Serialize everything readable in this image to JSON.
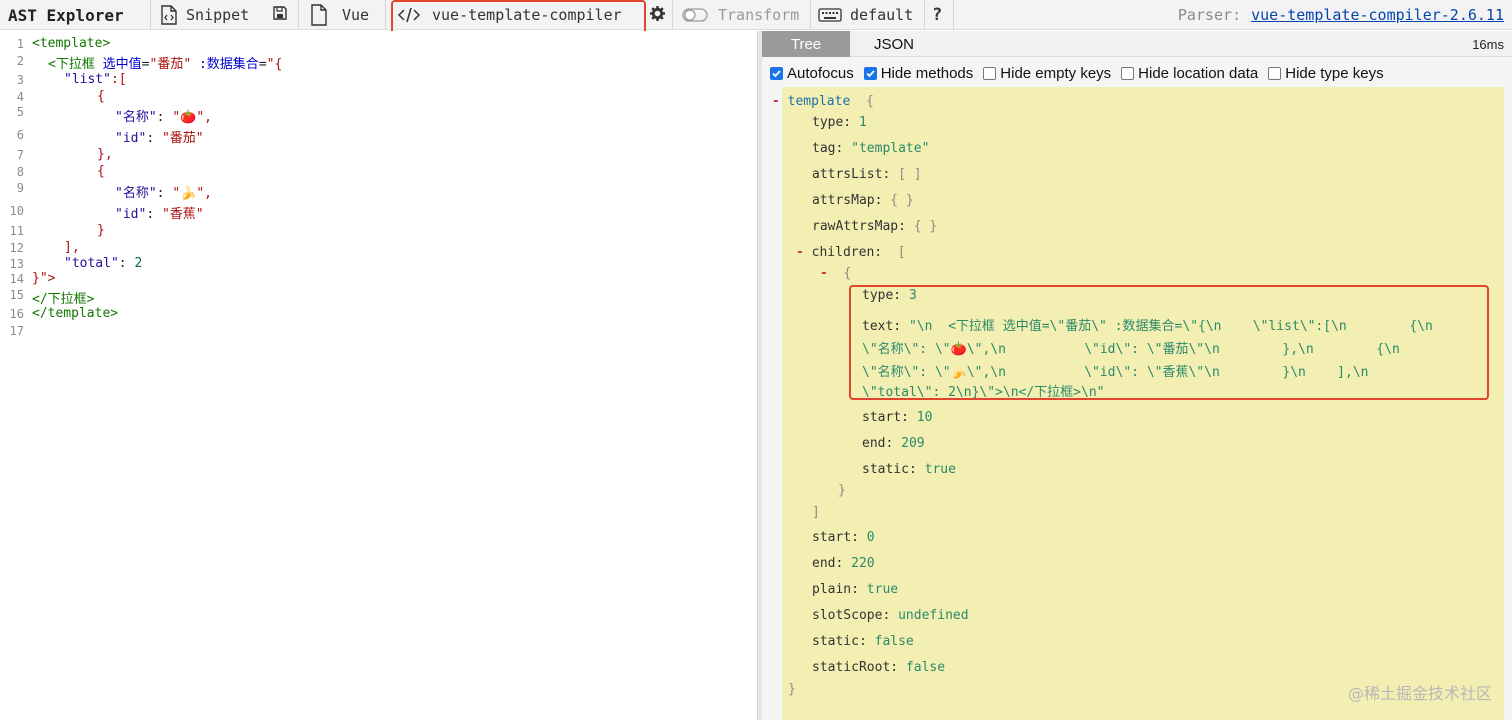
{
  "toolbar": {
    "app_title": "AST Explorer",
    "snippet_label": "Snippet",
    "language_label": "Vue",
    "parser_button_label": "vue-template-compiler",
    "transform_label": "Transform",
    "keymap_label": "default",
    "help_label": "?",
    "parser_label": "Parser:",
    "parser_link": "vue-template-compiler-2.6.11"
  },
  "editor": {
    "lines": [
      {
        "num": "1"
      },
      {
        "num": "2"
      },
      {
        "num": "3"
      },
      {
        "num": "4"
      },
      {
        "num": "5"
      },
      {
        "num": "6"
      },
      {
        "num": "7"
      },
      {
        "num": "8"
      },
      {
        "num": "9"
      },
      {
        "num": "10"
      },
      {
        "num": "11"
      },
      {
        "num": "12"
      },
      {
        "num": "13"
      },
      {
        "num": "14"
      },
      {
        "num": "15"
      },
      {
        "num": "16"
      },
      {
        "num": "17"
      }
    ],
    "code": {
      "l1": "<template>",
      "l2_tag": "<下拉框",
      "l2_attr1": "选中值",
      "l2_eq1": "=",
      "l2_val1": "\"番茄\"",
      "l2_attr2": ":数据集合",
      "l2_eq2": "=",
      "l2_val2": "\"{",
      "l3_key": "\"list\"",
      "l3_rest": ":[",
      "l4": "{",
      "l5_key": "\"名称\"",
      "l5_colon": ": ",
      "l5_val": "\"🍅\"",
      "l5_comma": ",",
      "l6_key": "\"id\"",
      "l6_colon": ": ",
      "l6_val": "\"番茄\"",
      "l7": "},",
      "l8": "{",
      "l9_key": "\"名称\"",
      "l9_colon": ": ",
      "l9_val": "\"🍌\"",
      "l9_comma": ",",
      "l10_key": "\"id\"",
      "l10_colon": ": ",
      "l10_val": "\"香蕉\"",
      "l11": "}",
      "l12": "],",
      "l13_key": "\"total\"",
      "l13_colon": ": ",
      "l13_val": "2",
      "l14": "}\">",
      "l15": "</下拉框>",
      "l16": "</template>"
    }
  },
  "output": {
    "tabs": [
      {
        "label": "Tree"
      },
      {
        "label": "JSON"
      }
    ],
    "timing": "16ms",
    "options": [
      {
        "label": "Autofocus",
        "checked": true
      },
      {
        "label": "Hide methods",
        "checked": true
      },
      {
        "label": "Hide empty keys",
        "checked": false
      },
      {
        "label": "Hide location data",
        "checked": false
      },
      {
        "label": "Hide type keys",
        "checked": false
      }
    ],
    "tree": {
      "root_toggle": "-",
      "root_name": "template",
      "open_brace": "{",
      "type_key": "type:",
      "type_val": "1",
      "tag_key": "tag:",
      "tag_val": "\"template\"",
      "attrsList_key": "attrsList:",
      "attrsList_val": "[ ]",
      "attrsMap_key": "attrsMap:",
      "attrsMap_val": "{ }",
      "rawAttrsMap_key": "rawAttrsMap:",
      "rawAttrsMap_val": "{ }",
      "children_toggle": "-",
      "children_key": "children:",
      "children_open": "[",
      "child_toggle": "-",
      "child_open": "{",
      "child_type_key": "type:",
      "child_type_val": "3",
      "child_text_key": "text:",
      "child_text_l1": "\"\\n  <下拉框 选中值=\\\"番茄\\\" :数据集合=\\\"{\\n    \\\"list\\\":[\\n        {\\n",
      "child_text_l2": "\\\"名称\\\": \\\"🍅\\\",\\n          \\\"id\\\": \\\"番茄\\\"\\n        },\\n        {\\n",
      "child_text_l3": "\\\"名称\\\": \\\"🍌\\\",\\n          \\\"id\\\": \\\"香蕉\\\"\\n        }\\n    ],\\n",
      "child_text_l4": "\\\"total\\\": 2\\n}\\\">\\n</下拉框>\\n\"",
      "child_start_key": "start:",
      "child_start_val": "10",
      "child_end_key": "end:",
      "child_end_val": "209",
      "child_static_key": "static:",
      "child_static_val": "true",
      "child_close": "}",
      "children_close": "]",
      "start_key": "start:",
      "start_val": "0",
      "end_key": "end:",
      "end_val": "220",
      "plain_key": "plain:",
      "plain_val": "true",
      "slotScope_key": "slotScope:",
      "slotScope_val": "undefined",
      "static_key": "static:",
      "static_val": "false",
      "staticRoot_key": "staticRoot:",
      "staticRoot_val": "false",
      "close_brace": "}"
    }
  },
  "watermark": "@稀土掘金技术社区",
  "colors": {
    "highlight_box": "#e0452f",
    "tree_bg": "#f3efb3",
    "link": "#0645ad",
    "active_tab": "#9a9a9a"
  },
  "icons": [
    "code-icon",
    "save-icon",
    "file-icon",
    "gear-icon",
    "toggle-icon",
    "keyboard-icon"
  ]
}
